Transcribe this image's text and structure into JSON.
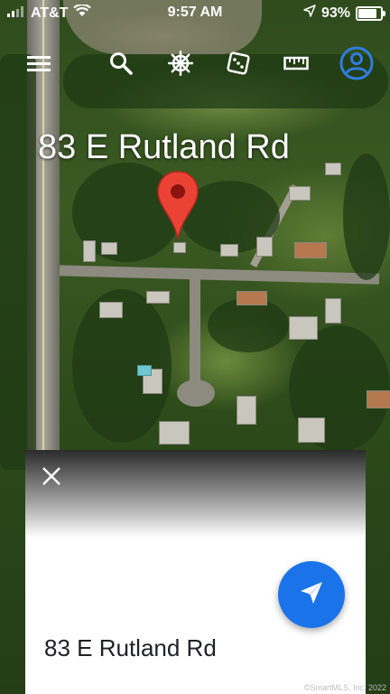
{
  "status_bar": {
    "carrier": "AT&T",
    "time": "9:57 AM",
    "battery": "93%",
    "battery_level": 0.93,
    "icons": [
      "signal-icon",
      "wifi-icon",
      "location-arrow-icon",
      "battery-icon"
    ]
  },
  "toolbar": {
    "icons": [
      "menu-icon",
      "search-icon",
      "voyager-icon",
      "dice-icon",
      "ruler-icon",
      "account-icon"
    ]
  },
  "map": {
    "label": "83 E Rutland Rd",
    "marker": "red-map-pin"
  },
  "card": {
    "address": "83 E Rutland Rd",
    "close_icon": "close-icon",
    "action_icon": "fly-to-icon",
    "action_color": "#1a73e8"
  },
  "watermark": "©SmartMLS, Inc. 2022"
}
